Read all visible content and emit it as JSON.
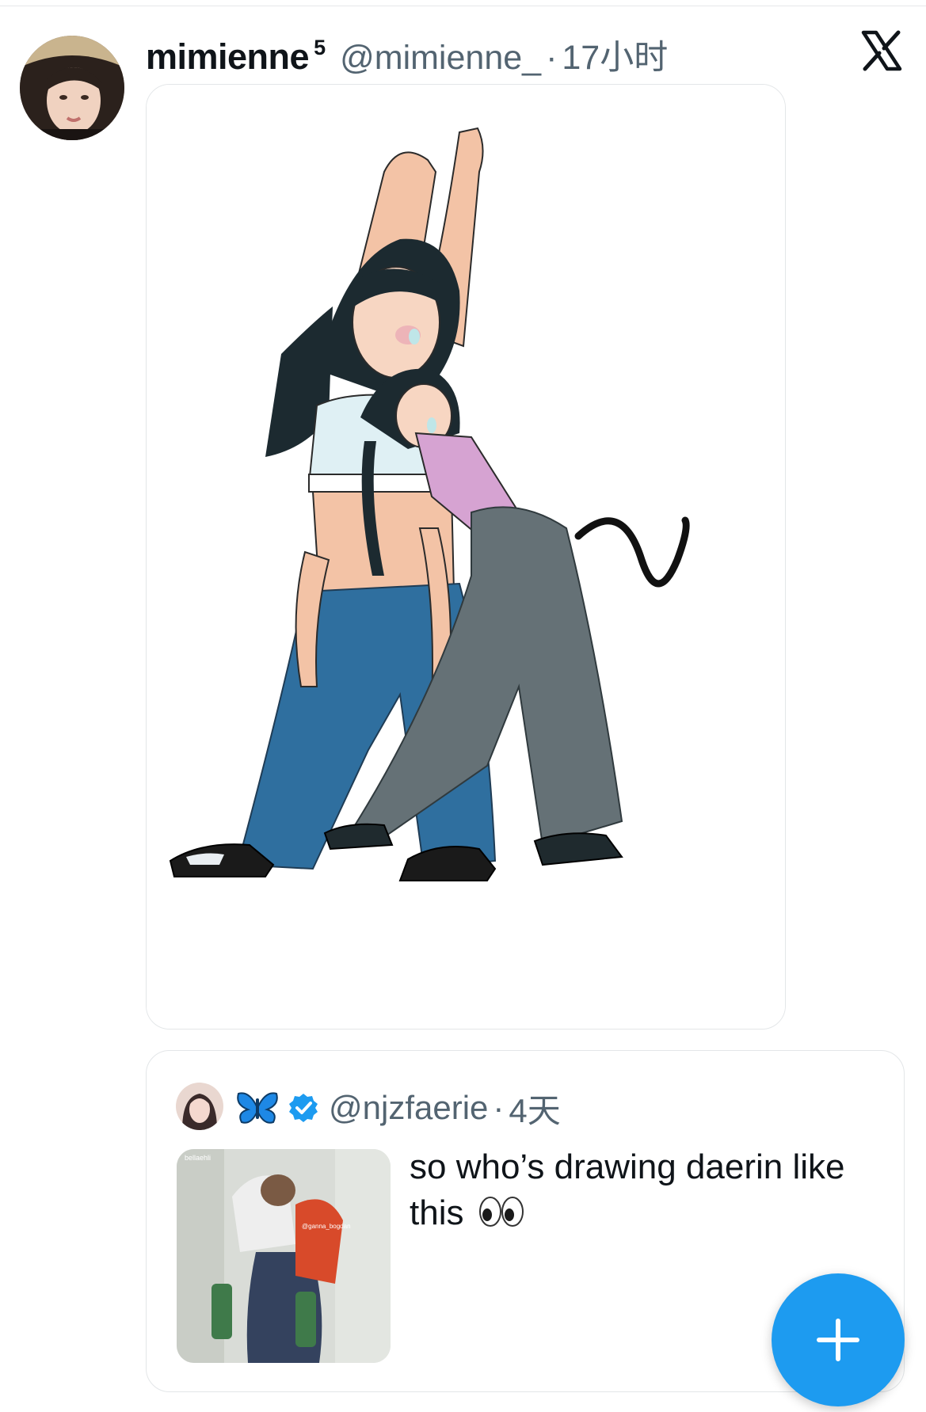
{
  "tweet": {
    "display_name": "mimienne",
    "name_badge": "5",
    "handle": "@mimienne_",
    "separator": "·",
    "timestamp": "17小时",
    "platform_icon": "x-logo-icon",
    "media": {
      "type": "illustration",
      "icon": "drawing-image"
    }
  },
  "quoted_tweet": {
    "display_emoji_icon": "butterfly-icon",
    "verified_icon": "verified-badge-icon",
    "handle": "@njzfaerie",
    "separator": "·",
    "timestamp": "4天",
    "text": "so who’s drawing daerin like this",
    "text_emoji_icon": "eyes-icon",
    "thumbnail_watermarks": [
      "bellaehli",
      "@ganna_bogdan"
    ]
  },
  "fab": {
    "icon": "plus-icon",
    "color": "#1d9bf0"
  },
  "colors": {
    "primary_text": "#0f1419",
    "secondary_text": "#536471",
    "accent": "#1d9bf0",
    "border": "#e3e6e8"
  }
}
